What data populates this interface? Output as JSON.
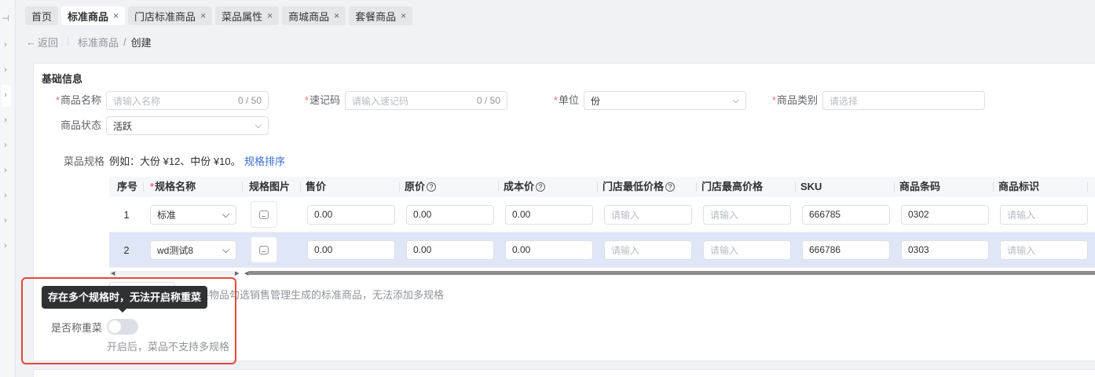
{
  "tabs": [
    {
      "label": "首页",
      "active": false,
      "closable": false
    },
    {
      "label": "标准商品",
      "active": true,
      "closable": true
    },
    {
      "label": "门店标准商品",
      "active": false,
      "closable": true
    },
    {
      "label": "菜品属性",
      "active": false,
      "closable": true
    },
    {
      "label": "商城商品",
      "active": false,
      "closable": true
    },
    {
      "label": "套餐商品",
      "active": false,
      "closable": true
    }
  ],
  "tab_close_glyph": "×",
  "breadcrumb": {
    "back": "返回",
    "parent": "标准商品",
    "separator": "/",
    "current": "创建"
  },
  "section": {
    "title": "基础信息"
  },
  "form": {
    "name": {
      "label": "商品名称",
      "required": true,
      "placeholder": "请输入名称",
      "count": "0 / 50"
    },
    "code": {
      "label": "速记码",
      "required": true,
      "placeholder": "请输入速记码",
      "count": "0 / 50"
    },
    "unit": {
      "label": "单位",
      "required": true,
      "value": "份"
    },
    "category": {
      "label": "商品类别",
      "required": true,
      "placeholder": "请选择"
    },
    "status": {
      "label": "商品状态",
      "value": "活跃"
    },
    "required_mark": "*"
  },
  "spec": {
    "label": "菜品规格",
    "example": "例如：大份 ¥12、中份 ¥10。",
    "sort_link": "规格排序"
  },
  "table": {
    "headers": [
      "序号",
      "规格名称",
      "规格图片",
      "售价",
      "原价",
      "成本价",
      "门店最低价格",
      "门店最高价格",
      "SKU",
      "商品条码",
      "商品标识"
    ],
    "help_glyph": "?",
    "input_placeholder": "请输入",
    "rows": [
      {
        "index": "1",
        "name": "标准",
        "price": "0.00",
        "original": "0.00",
        "cost": "0.00",
        "sku": "666785",
        "barcode": "0302"
      },
      {
        "index": "2",
        "name": "wd测试8",
        "price": "0.00",
        "original": "0.00",
        "cost": "0.00",
        "sku": "666786",
        "barcode": "0303"
      }
    ]
  },
  "hint_text": "链物品勾选销售管理生成的标准商品，无法添加多规格",
  "weigh": {
    "label": "是否称重菜",
    "enabled": false,
    "note": "开启后，菜品不支持多规格"
  },
  "tooltip": "存在多个规格时，无法开启称重菜",
  "colors": {
    "accent": "#3a6fd8",
    "required": "#f56c6c",
    "highlight": "#e8473e",
    "selected_row": "#dfe7f7",
    "tooltip_bg": "#303133"
  }
}
